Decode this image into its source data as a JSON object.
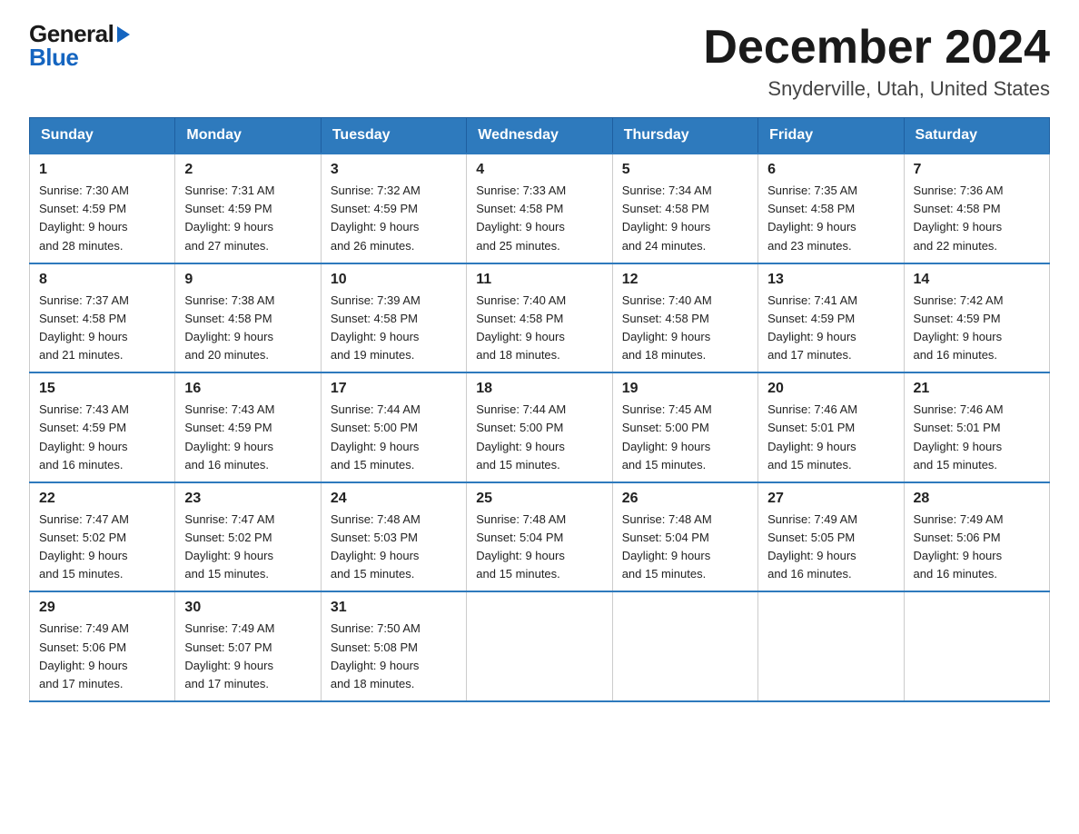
{
  "header": {
    "logo_general": "General",
    "logo_blue": "Blue",
    "month_title": "December 2024",
    "location": "Snyderville, Utah, United States"
  },
  "weekdays": [
    "Sunday",
    "Monday",
    "Tuesday",
    "Wednesday",
    "Thursday",
    "Friday",
    "Saturday"
  ],
  "weeks": [
    [
      {
        "day": "1",
        "sunrise": "7:30 AM",
        "sunset": "4:59 PM",
        "daylight": "9 hours and 28 minutes."
      },
      {
        "day": "2",
        "sunrise": "7:31 AM",
        "sunset": "4:59 PM",
        "daylight": "9 hours and 27 minutes."
      },
      {
        "day": "3",
        "sunrise": "7:32 AM",
        "sunset": "4:59 PM",
        "daylight": "9 hours and 26 minutes."
      },
      {
        "day": "4",
        "sunrise": "7:33 AM",
        "sunset": "4:58 PM",
        "daylight": "9 hours and 25 minutes."
      },
      {
        "day": "5",
        "sunrise": "7:34 AM",
        "sunset": "4:58 PM",
        "daylight": "9 hours and 24 minutes."
      },
      {
        "day": "6",
        "sunrise": "7:35 AM",
        "sunset": "4:58 PM",
        "daylight": "9 hours and 23 minutes."
      },
      {
        "day": "7",
        "sunrise": "7:36 AM",
        "sunset": "4:58 PM",
        "daylight": "9 hours and 22 minutes."
      }
    ],
    [
      {
        "day": "8",
        "sunrise": "7:37 AM",
        "sunset": "4:58 PM",
        "daylight": "9 hours and 21 minutes."
      },
      {
        "day": "9",
        "sunrise": "7:38 AM",
        "sunset": "4:58 PM",
        "daylight": "9 hours and 20 minutes."
      },
      {
        "day": "10",
        "sunrise": "7:39 AM",
        "sunset": "4:58 PM",
        "daylight": "9 hours and 19 minutes."
      },
      {
        "day": "11",
        "sunrise": "7:40 AM",
        "sunset": "4:58 PM",
        "daylight": "9 hours and 18 minutes."
      },
      {
        "day": "12",
        "sunrise": "7:40 AM",
        "sunset": "4:58 PM",
        "daylight": "9 hours and 18 minutes."
      },
      {
        "day": "13",
        "sunrise": "7:41 AM",
        "sunset": "4:59 PM",
        "daylight": "9 hours and 17 minutes."
      },
      {
        "day": "14",
        "sunrise": "7:42 AM",
        "sunset": "4:59 PM",
        "daylight": "9 hours and 16 minutes."
      }
    ],
    [
      {
        "day": "15",
        "sunrise": "7:43 AM",
        "sunset": "4:59 PM",
        "daylight": "9 hours and 16 minutes."
      },
      {
        "day": "16",
        "sunrise": "7:43 AM",
        "sunset": "4:59 PM",
        "daylight": "9 hours and 16 minutes."
      },
      {
        "day": "17",
        "sunrise": "7:44 AM",
        "sunset": "5:00 PM",
        "daylight": "9 hours and 15 minutes."
      },
      {
        "day": "18",
        "sunrise": "7:44 AM",
        "sunset": "5:00 PM",
        "daylight": "9 hours and 15 minutes."
      },
      {
        "day": "19",
        "sunrise": "7:45 AM",
        "sunset": "5:00 PM",
        "daylight": "9 hours and 15 minutes."
      },
      {
        "day": "20",
        "sunrise": "7:46 AM",
        "sunset": "5:01 PM",
        "daylight": "9 hours and 15 minutes."
      },
      {
        "day": "21",
        "sunrise": "7:46 AM",
        "sunset": "5:01 PM",
        "daylight": "9 hours and 15 minutes."
      }
    ],
    [
      {
        "day": "22",
        "sunrise": "7:47 AM",
        "sunset": "5:02 PM",
        "daylight": "9 hours and 15 minutes."
      },
      {
        "day": "23",
        "sunrise": "7:47 AM",
        "sunset": "5:02 PM",
        "daylight": "9 hours and 15 minutes."
      },
      {
        "day": "24",
        "sunrise": "7:48 AM",
        "sunset": "5:03 PM",
        "daylight": "9 hours and 15 minutes."
      },
      {
        "day": "25",
        "sunrise": "7:48 AM",
        "sunset": "5:04 PM",
        "daylight": "9 hours and 15 minutes."
      },
      {
        "day": "26",
        "sunrise": "7:48 AM",
        "sunset": "5:04 PM",
        "daylight": "9 hours and 15 minutes."
      },
      {
        "day": "27",
        "sunrise": "7:49 AM",
        "sunset": "5:05 PM",
        "daylight": "9 hours and 16 minutes."
      },
      {
        "day": "28",
        "sunrise": "7:49 AM",
        "sunset": "5:06 PM",
        "daylight": "9 hours and 16 minutes."
      }
    ],
    [
      {
        "day": "29",
        "sunrise": "7:49 AM",
        "sunset": "5:06 PM",
        "daylight": "9 hours and 17 minutes."
      },
      {
        "day": "30",
        "sunrise": "7:49 AM",
        "sunset": "5:07 PM",
        "daylight": "9 hours and 17 minutes."
      },
      {
        "day": "31",
        "sunrise": "7:50 AM",
        "sunset": "5:08 PM",
        "daylight": "9 hours and 18 minutes."
      },
      null,
      null,
      null,
      null
    ]
  ],
  "labels": {
    "sunrise": "Sunrise:",
    "sunset": "Sunset:",
    "daylight": "Daylight:"
  }
}
